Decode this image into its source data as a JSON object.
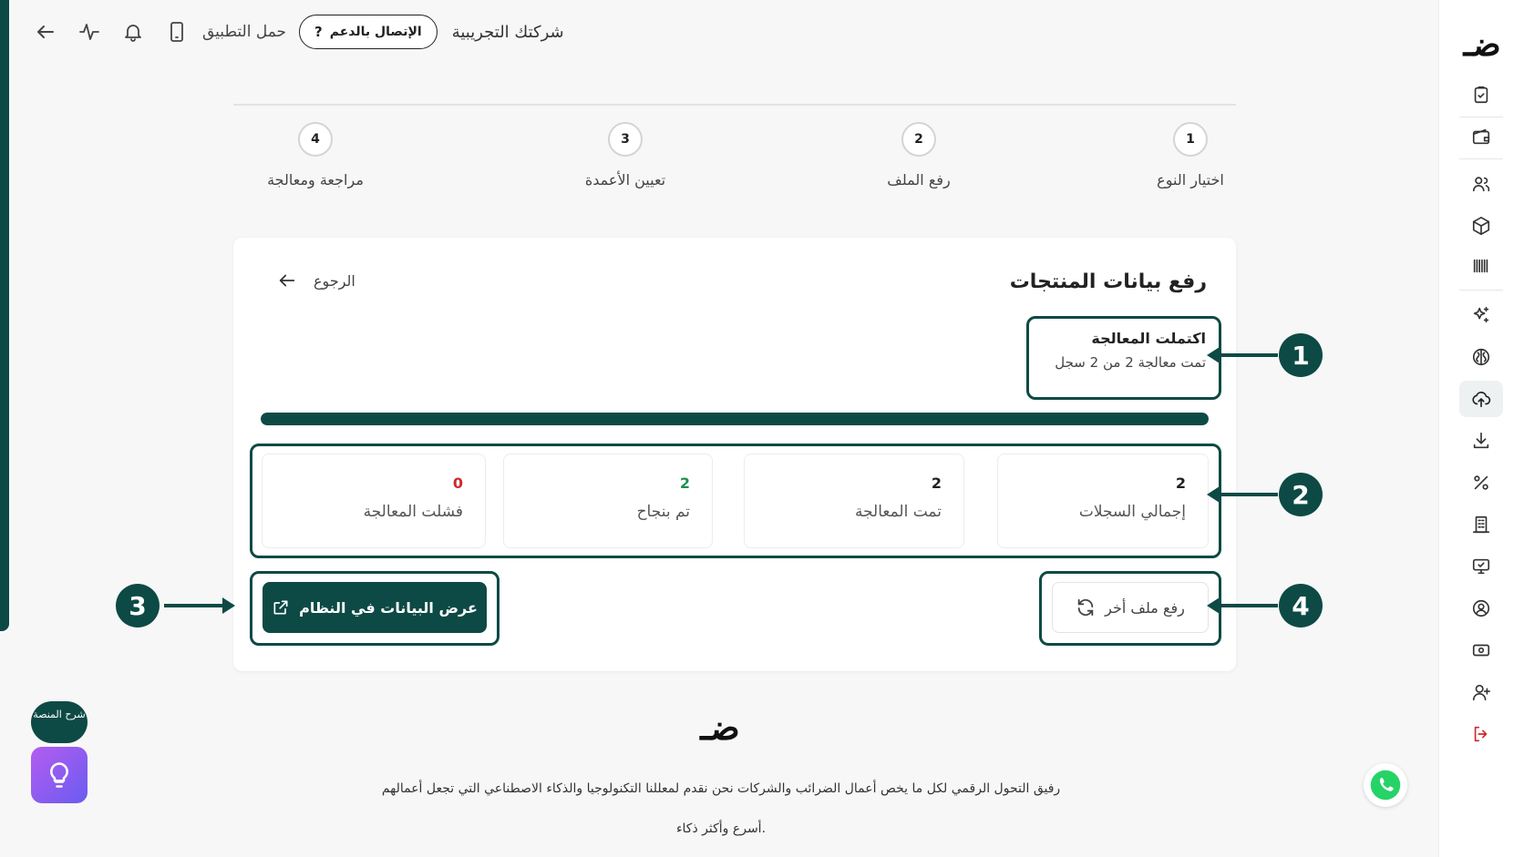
{
  "topbar": {
    "download_app": "حمل التطبيق",
    "support_label": "الإتصال بالدعم",
    "support_icon": "?",
    "company": "شركتك التجريبية"
  },
  "stepper": {
    "steps": [
      {
        "num": "1",
        "label": "اختيار النوع"
      },
      {
        "num": "2",
        "label": "رفع الملف"
      },
      {
        "num": "3",
        "label": "تعيين الأعمدة"
      },
      {
        "num": "4",
        "label": "مراجعة ومعالجة"
      }
    ]
  },
  "card": {
    "title": "رفع بيانات المنتجات",
    "back_label": "الرجوع",
    "status_title": "اكتملت المعالجة",
    "status_detail": "تمت معالجة 2 من 2 سجل",
    "progress": 1.0,
    "stats": [
      {
        "value": "2",
        "label": "إجمالي السجلات"
      },
      {
        "value": "2",
        "label": "تمت المعالجة"
      },
      {
        "value": "2",
        "label": "تم بنجاح"
      },
      {
        "value": "0",
        "label": "فشلت المعالجة"
      }
    ],
    "view_data_label": "عرض البيانات في النظام",
    "upload_another_label": "رفع ملف أخر"
  },
  "callouts": [
    "1",
    "2",
    "3",
    "4"
  ],
  "footer": {
    "logo": "ضـ",
    "line1": "رفيق التحول الرقمي لكل ما يخص أعمال الضرائب والشركات نحن نقدم لمعللنا التكنولوجيا والذكاء الاصطناعي التي تجعل أعمالهم",
    "line2": "أسرع وأكثر ذكاء."
  },
  "sidebar": {
    "logo": "ضـ"
  },
  "help": {
    "label": "شرح المنصة"
  },
  "colors": {
    "brand": "#0d4a45",
    "success": "#1f8f50",
    "danger": "#d0282d",
    "logout": "#d0282d"
  },
  "icons": [
    "back-arrow-icon",
    "activity-icon",
    "bell-icon",
    "phone-icon",
    "clipboard-check-icon",
    "wallet-icon",
    "users-icon",
    "box-icon",
    "barcode-icon",
    "sparkles-icon",
    "brain-icon",
    "upload-cloud-icon",
    "download-icon",
    "percent-icon",
    "building-icon",
    "monitor-check-icon",
    "user-circle-icon",
    "cash-icon",
    "user-plus-icon",
    "logout-icon",
    "external-link-icon",
    "refresh-icon",
    "lightbulb-icon",
    "whatsapp-icon"
  ]
}
